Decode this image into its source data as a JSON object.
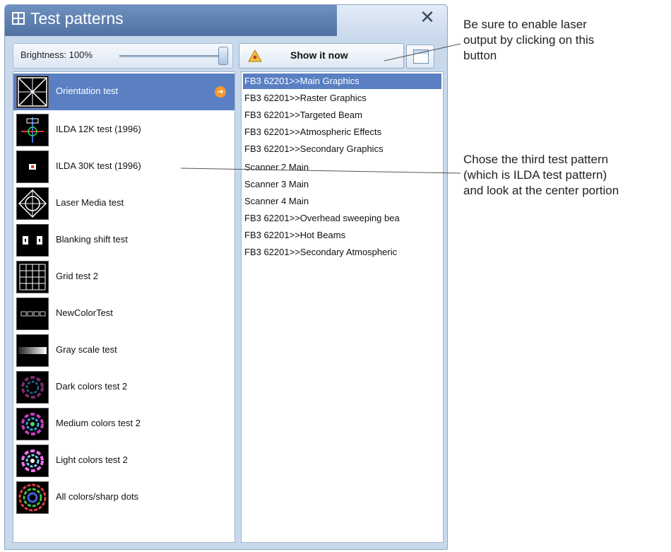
{
  "window": {
    "title": "Test patterns",
    "close_glyph": "✕"
  },
  "toolbar": {
    "brightness_label": "Brightness: 100%",
    "brightness_value": 1.0,
    "show_button_label": "Show it now"
  },
  "patterns": [
    {
      "label": "Orientation test",
      "selected": true,
      "icon": "orientation-thumb"
    },
    {
      "label": "ILDA 12K test (1996)",
      "icon": "ilda12k-thumb"
    },
    {
      "label": "ILDA 30K test (1996)",
      "icon": "ilda30k-thumb"
    },
    {
      "label": "Laser Media test",
      "icon": "laser-media-thumb"
    },
    {
      "label": "Blanking shift test",
      "icon": "blanking-thumb"
    },
    {
      "label": "Grid test 2",
      "icon": "grid-thumb"
    },
    {
      "label": "NewColorTest",
      "icon": "newcolor-thumb"
    },
    {
      "label": "Gray scale test",
      "icon": "grayscale-thumb"
    },
    {
      "label": "Dark colors test 2",
      "icon": "dark-colors-thumb"
    },
    {
      "label": "Medium colors test 2",
      "icon": "medium-colors-thumb"
    },
    {
      "label": "Light colors test 2",
      "icon": "light-colors-thumb"
    },
    {
      "label": "All colors/sharp dots",
      "icon": "all-colors-thumb"
    }
  ],
  "scanners": [
    {
      "label": "FB3 62201>>Main Graphics",
      "selected": true
    },
    {
      "label": "FB3 62201>>Raster Graphics"
    },
    {
      "label": "FB3 62201>>Targeted Beam"
    },
    {
      "label": "FB3 62201>>Atmospheric Effects"
    },
    {
      "label": "FB3 62201>>Secondary Graphics"
    },
    {
      "label": "Scanner 2 Main"
    },
    {
      "label": "Scanner 3 Main"
    },
    {
      "label": "Scanner 4 Main"
    },
    {
      "label": "FB3 62201>>Overhead sweeping bea"
    },
    {
      "label": "FB3 62201>>Hot Beams"
    },
    {
      "label": "FB3 62201>>Secondary Atmospheric"
    }
  ],
  "annotations": {
    "note1_line1": "Be sure to enable laser",
    "note1_line2": "output by clicking on this",
    "note1_line3": "button",
    "note2_line1": "Chose the third test pattern",
    "note2_line2": "(which is ILDA test pattern)",
    "note2_line3": "and look at the center portion"
  },
  "colors": {
    "selection": "#5a7fc3",
    "title_bar": "#5b7eb0",
    "accent_arrow": "#f39a2c"
  }
}
